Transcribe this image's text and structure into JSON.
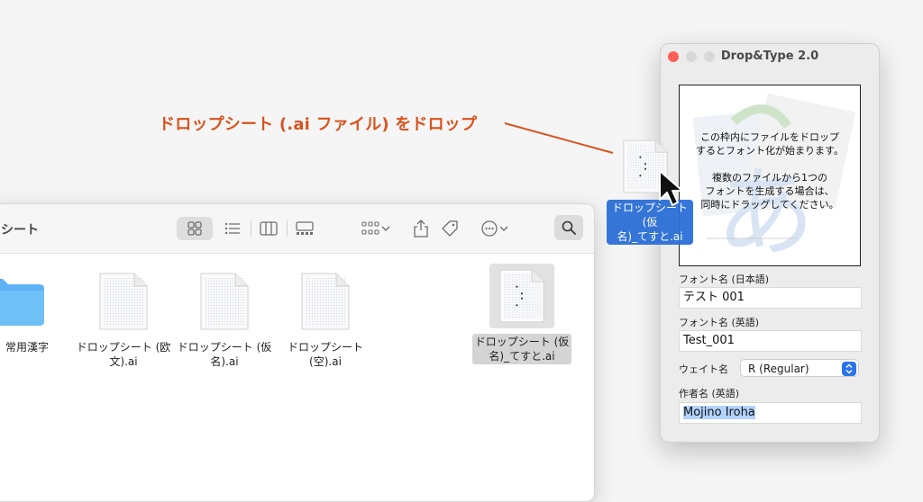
{
  "annotation": {
    "text": "ドロップシート (.ai ファイル) をドロップ",
    "color": "#d9531e"
  },
  "finder": {
    "title_partial": "シート",
    "toolbar": {
      "icons": [
        "grid-view-icon",
        "list-view-icon",
        "column-view-icon",
        "gallery-view-icon",
        "group-by-icon",
        "share-icon",
        "tag-icon",
        "more-actions-icon",
        "search-icon"
      ]
    },
    "files": [
      {
        "label_line1": "常用漢字",
        "label_line2": "",
        "kind": "folder"
      },
      {
        "label_line1": "ドロップシート (欧",
        "label_line2": "文).ai",
        "kind": "ai"
      },
      {
        "label_line1": "ドロップシート (仮",
        "label_line2": "名).ai",
        "kind": "ai"
      },
      {
        "label_line1": "ドロップシート",
        "label_line2": "(空).ai",
        "kind": "ai"
      },
      {
        "label_line1": "ドロップシート (仮",
        "label_line2": "名)_てすと.ai",
        "kind": "ai",
        "selected": true
      }
    ]
  },
  "drag": {
    "label_line1": "ドロップシート (仮",
    "label_line2": "名)_てすと.ai"
  },
  "app": {
    "title": "Drop&Type 2.0",
    "drop_zone": {
      "line1": "この枠内にファイルをドロップ",
      "line2": "するとフォント化が始まります。",
      "line3": "複数のファイルから1つの",
      "line4": "フォントを生成する場合は、",
      "line5": "同時にドラッグしてください。"
    },
    "font_name_jp_label": "フォント名 (日本語)",
    "font_name_jp_value": "テスト 001",
    "font_name_en_label": "フォント名 (英語)",
    "font_name_en_value": "Test_001",
    "weight_label": "ウェイト名",
    "weight_value": "R (Regular)",
    "author_label": "作者名 (英語)",
    "author_value": "Mojino Iroha"
  },
  "colors": {
    "accent": "#2b74e8",
    "close": "#ff5f57",
    "selection": "#b3d3ff"
  }
}
